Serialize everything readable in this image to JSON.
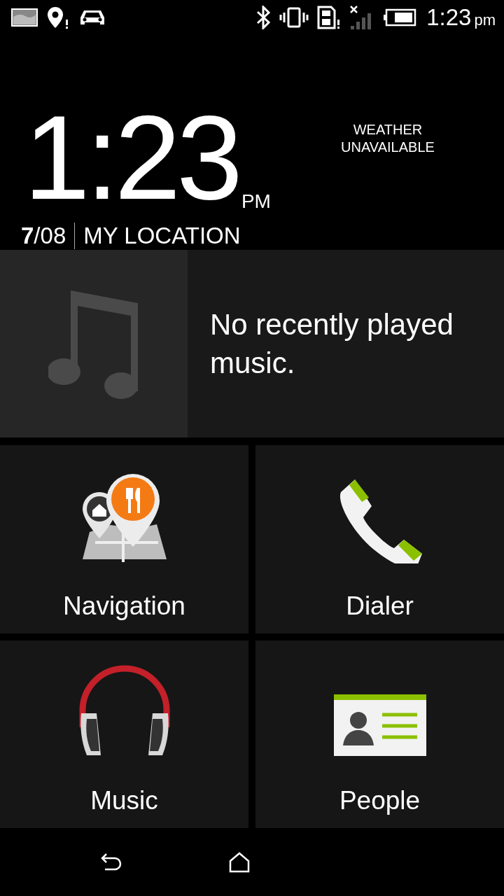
{
  "status_bar": {
    "time": "1:23",
    "ampm": "pm"
  },
  "clock": {
    "time": "1:23",
    "ampm": "PM",
    "date": "**7**/08",
    "location": "MY LOCATION",
    "weather": "WEATHER UNAVAILABLE"
  },
  "music_card": {
    "message": "No recently played music."
  },
  "tiles": [
    {
      "kind": "navigation",
      "label": "Navigation"
    },
    {
      "kind": "dialer",
      "label": "Dialer"
    },
    {
      "kind": "music",
      "label": "Music"
    },
    {
      "kind": "people",
      "label": "People"
    }
  ]
}
